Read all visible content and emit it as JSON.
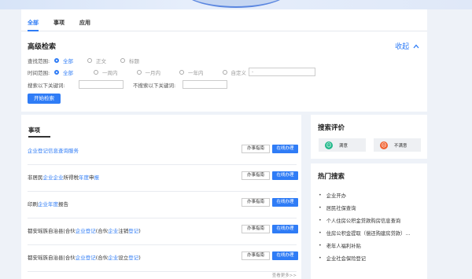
{
  "tabs": [
    "全部",
    "事项",
    "应用"
  ],
  "advanced": {
    "title": "高级检索",
    "collapse_label": "收起",
    "scope": {
      "label": "查找范围:",
      "options": [
        "全部",
        "正文",
        "标题"
      ]
    },
    "time": {
      "label": "时间范围:",
      "options": [
        "全部",
        "一周内",
        "一月内",
        "一年内",
        "自定义"
      ],
      "custom_placeholder": "-"
    },
    "include_label": "搜索以下关键词:",
    "exclude_label": "不搜索以下关键词:",
    "search_button": "开始检索"
  },
  "items_section": {
    "title": "事项",
    "guide_label": "办事指南",
    "online_label": "在线办理",
    "more_label": "查看更多>>",
    "items": [
      {
        "full": "企业登记信息查询服务",
        "parts": [
          [
            "企业登记信息查询服务",
            true
          ]
        ]
      },
      {
        "full": "非居民企业企业所得税年度申报",
        "parts": [
          [
            "非居民",
            false
          ],
          [
            "企业企业",
            true
          ],
          [
            "所得税",
            false
          ],
          [
            "年度",
            true
          ],
          [
            "申",
            false
          ],
          [
            "报",
            true
          ]
        ]
      },
      {
        "full": "印刷企业年度报告",
        "parts": [
          [
            "印刷",
            false
          ],
          [
            "企业年度",
            true
          ],
          [
            "报告",
            false
          ]
        ]
      },
      {
        "full": "都安瑶族自治县|合伙企业登记|合伙企业注销登记|",
        "parts": [
          [
            "都安瑶族自治县|合伙",
            false
          ],
          [
            "企业登记",
            true
          ],
          [
            "(合伙",
            false
          ],
          [
            "企业",
            true
          ],
          [
            "注销",
            false
          ],
          [
            "登记",
            true
          ],
          [
            ")",
            false
          ]
        ]
      },
      {
        "full": "都安瑶族自治县|合伙企业登记|合伙企业设立登记|",
        "parts": [
          [
            "都安瑶族自治县|合伙",
            false
          ],
          [
            "企业登记",
            true
          ],
          [
            "(合伙",
            false
          ],
          [
            "企业",
            true
          ],
          [
            "设立",
            false
          ],
          [
            "登记",
            true
          ],
          [
            ")",
            false
          ]
        ]
      }
    ]
  },
  "rating": {
    "title": "搜索评价",
    "satisfied": "满意",
    "unsatisfied": "不满意"
  },
  "hot": {
    "title": "热门搜索",
    "items": [
      "企业开办",
      "居民社保查询",
      "个人住房公积金贷款购房信息查询",
      "住房公积金提取（偿还购建房贷款）...",
      "老年人福利补贴",
      "企业社会保险登记"
    ]
  }
}
